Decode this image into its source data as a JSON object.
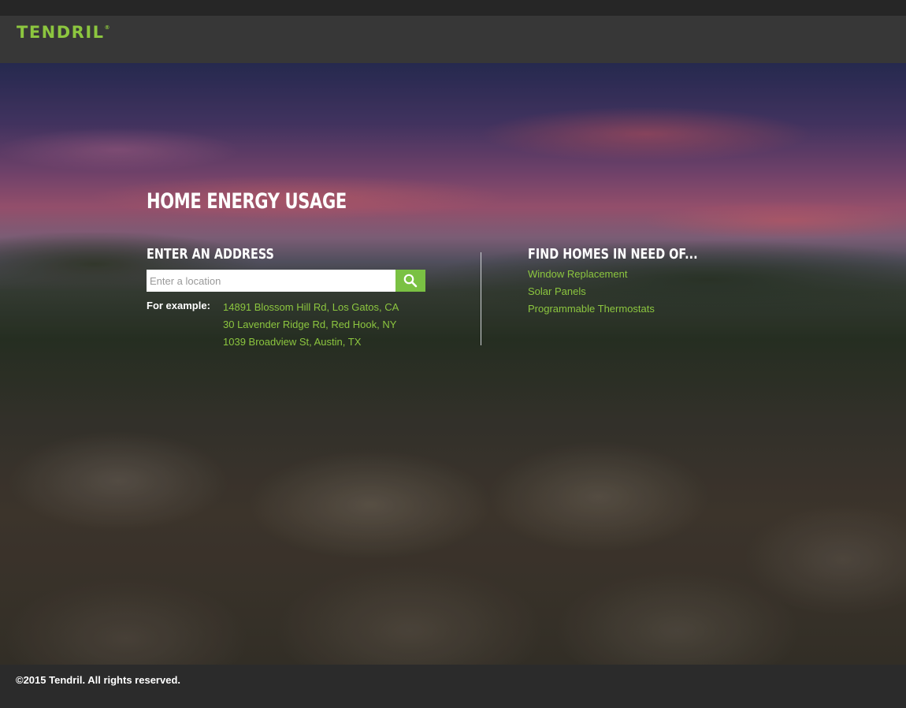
{
  "brand": {
    "logo_text": "TENDRIL",
    "registered_mark": "®",
    "accent_color": "#8cc63f"
  },
  "hero": {
    "title": "HOME ENERGY USAGE",
    "address_section": {
      "heading": "ENTER AN ADDRESS",
      "search_placeholder": "Enter a location",
      "search_icon": "search-icon",
      "example_label": "For example:",
      "examples": [
        "14891 Blossom Hill Rd, Los Gatos, CA",
        "30 Lavender Ridge Rd, Red Hook, NY",
        "1039 Broadview St, Austin, TX"
      ]
    },
    "needs_section": {
      "heading": "FIND HOMES IN NEED OF...",
      "items": [
        "Window Replacement",
        "Solar Panels",
        "Programmable Thermostats"
      ]
    }
  },
  "footer": {
    "copyright": "©2015 Tendril. All rights reserved."
  }
}
